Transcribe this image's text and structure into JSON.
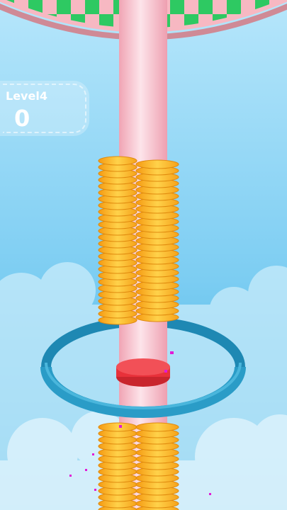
{
  "hud": {
    "level_label": "Level4",
    "score": "0"
  },
  "colors": {
    "sky_top": "#9fdcf6",
    "sky_bottom": "#2ea8de",
    "pole": "#f6b8c4",
    "ring_coins": "#f7a81b",
    "hoop": "#2a9cc7",
    "red_ring": "#e8313a",
    "checker_green": "#2ec962",
    "checker_pink": "#f7b8c2",
    "particle": "#e21ad6"
  }
}
